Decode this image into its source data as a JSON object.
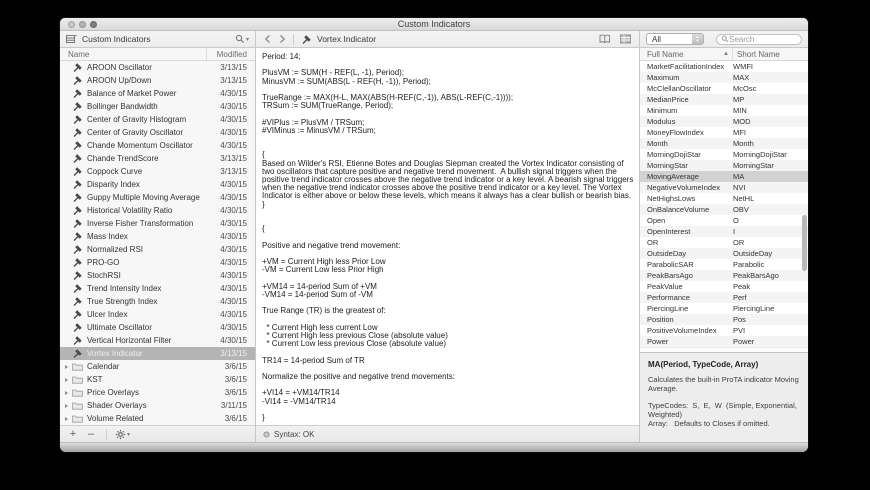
{
  "window": {
    "title": "Custom Indicators"
  },
  "colors": {
    "sidebar_selection": "#b4b4b4",
    "table_selection": "#d2d2d2",
    "window_chrome": "#ececec"
  },
  "sidebar": {
    "toolbar_title": "Custom Indicators",
    "columns": {
      "name": "Name",
      "modified": "Modified"
    },
    "items": [
      {
        "name": "AROON Oscillator",
        "date": "3/13/15",
        "type": "indicator"
      },
      {
        "name": "AROON Up/Down",
        "date": "3/13/15",
        "type": "indicator"
      },
      {
        "name": "Balance of Market Power",
        "date": "4/30/15",
        "type": "indicator"
      },
      {
        "name": "Bollinger Bandwidth",
        "date": "4/30/15",
        "type": "indicator"
      },
      {
        "name": "Center of Gravity Histogram",
        "date": "4/30/15",
        "type": "indicator"
      },
      {
        "name": "Center of Gravity Oscillator",
        "date": "4/30/15",
        "type": "indicator"
      },
      {
        "name": "Chande Momentum Oscillator",
        "date": "4/30/15",
        "type": "indicator"
      },
      {
        "name": "Chande TrendScore",
        "date": "3/13/15",
        "type": "indicator"
      },
      {
        "name": "Coppock Curve",
        "date": "3/13/15",
        "type": "indicator"
      },
      {
        "name": "Disparity Index",
        "date": "4/30/15",
        "type": "indicator"
      },
      {
        "name": "Guppy Multiple Moving Average",
        "date": "4/30/15",
        "type": "indicator"
      },
      {
        "name": "Historical Volatility Ratio",
        "date": "4/30/15",
        "type": "indicator"
      },
      {
        "name": "Inverse Fisher Transformation",
        "date": "4/30/15",
        "type": "indicator"
      },
      {
        "name": "Mass Index",
        "date": "4/30/15",
        "type": "indicator"
      },
      {
        "name": "Normalized RSI",
        "date": "4/30/15",
        "type": "indicator"
      },
      {
        "name": "PRO-GO",
        "date": "4/30/15",
        "type": "indicator"
      },
      {
        "name": "StochRSI",
        "date": "4/30/15",
        "type": "indicator"
      },
      {
        "name": "Trend Intensity Index",
        "date": "4/30/15",
        "type": "indicator"
      },
      {
        "name": "True Strength Index",
        "date": "4/30/15",
        "type": "indicator"
      },
      {
        "name": "Ulcer Index",
        "date": "4/30/15",
        "type": "indicator"
      },
      {
        "name": "Ultimate Oscillator",
        "date": "4/30/15",
        "type": "indicator"
      },
      {
        "name": "Vertical Horizontal Filter",
        "date": "4/30/15",
        "type": "indicator"
      },
      {
        "name": "Vortex Indicator",
        "date": "3/13/15",
        "type": "indicator",
        "selected": true
      },
      {
        "name": "Calendar",
        "date": "3/6/15",
        "type": "folder"
      },
      {
        "name": "KST",
        "date": "3/6/15",
        "type": "folder"
      },
      {
        "name": "Price Overlays",
        "date": "3/6/15",
        "type": "folder"
      },
      {
        "name": "Shader Overlays",
        "date": "3/11/15",
        "type": "folder"
      },
      {
        "name": "Volume Related",
        "date": "3/6/15",
        "type": "folder"
      }
    ],
    "footer": {
      "add": "+",
      "remove": "–"
    }
  },
  "editor": {
    "nav_title": "Vortex Indicator",
    "status": "Syntax: OK",
    "code": "Period: 14;\n\nPlusVM := SUM(H - REF(L, -1), Period);\nMinusVM := SUM(ABS(L - REF(H, -1)), Period);\n\nTrueRange := MAX(H-L, MAX(ABS(H-REF(C,-1)), ABS(L-REF(C,-1))));\nTRSum := SUM(TrueRange, Period);\n\n#VIPlus := PlusVM / TRSum;\n#VIMinus := MinusVM / TRSum;\n\n\n{\nBased on Wilder's RSI, Etienne Botes and Douglas Siepman created the Vortex Indicator consisting of two oscillators that capture positive and negative trend movement.  A bullish signal triggers when the positive trend indicator crosses above the negative trend indicator or a key level. A bearish signal triggers when the negative trend indicator crosses above the positive trend indicator or a key level. The Vortex Indicator is either above or below these levels, which means it always has a clear bullish or bearish bias.\n}\n\n\n{\n\nPositive and negative trend movement:\n\n+VM = Current High less Prior Low\n-VM = Current Low less Prior High\n\n+VM14 = 14-period Sum of +VM\n-VM14 = 14-period Sum of -VM\n\nTrue Range (TR) is the greatest of:\n\n  * Current High less current Low\n  * Current High less previous Close (absolute value)\n  * Current Low less previous Close (absolute value)\n\nTR14 = 14-period Sum of TR\n\nNormalize the positive and negative trend movements:\n\n+VI14 = +VM14/TR14\n-VI14 = -VM14/TR14\n\n}"
  },
  "functions": {
    "filter_value": "All",
    "search_placeholder": "Search",
    "columns": {
      "full": "Full Name",
      "short": "Short Name",
      "sort_indicator": "▲"
    },
    "rows": [
      {
        "full": "MarketFacilitationIndex",
        "short": "WMFI"
      },
      {
        "full": "Maximum",
        "short": "MAX"
      },
      {
        "full": "McClellanOscillator",
        "short": "McOsc"
      },
      {
        "full": "MedianPrice",
        "short": "MP"
      },
      {
        "full": "Minimum",
        "short": "MIN"
      },
      {
        "full": "Modulus",
        "short": "MOD"
      },
      {
        "full": "MoneyFlowIndex",
        "short": "MFI"
      },
      {
        "full": "Month",
        "short": "Month"
      },
      {
        "full": "MorningDojiStar",
        "short": "MorningDojiStar"
      },
      {
        "full": "MorningStar",
        "short": "MorningStar"
      },
      {
        "full": "MovingAverage",
        "short": "MA",
        "selected": true
      },
      {
        "full": "NegativeVolumeIndex",
        "short": "NVI"
      },
      {
        "full": "NetHighsLows",
        "short": "NetHL"
      },
      {
        "full": "OnBalanceVolume",
        "short": "OBV"
      },
      {
        "full": "Open",
        "short": "O"
      },
      {
        "full": "OpenInterest",
        "short": "I"
      },
      {
        "full": "OR",
        "short": "OR"
      },
      {
        "full": "OutsideDay",
        "short": "OutsideDay"
      },
      {
        "full": "ParabolicSAR",
        "short": "Parabolic"
      },
      {
        "full": "PeakBarsAgo",
        "short": "PeakBarsAgo"
      },
      {
        "full": "PeakValue",
        "short": "Peak"
      },
      {
        "full": "Performance",
        "short": "Perf"
      },
      {
        "full": "PiercingLine",
        "short": "PiercingLine"
      },
      {
        "full": "Position",
        "short": "Pos"
      },
      {
        "full": "PositiveVolumeIndex",
        "short": "PVI"
      },
      {
        "full": "Power",
        "short": "Power"
      }
    ],
    "detail": {
      "signature": "MA(Period, TypeCode, Array)",
      "description": "Calculates the built-in ProTA indicator Moving Average.",
      "notes": "TypeCodes:  S,  E,  W  (Simple, Exponential, Weighted)\nArray:   Defaults to Closes if omitted."
    }
  }
}
